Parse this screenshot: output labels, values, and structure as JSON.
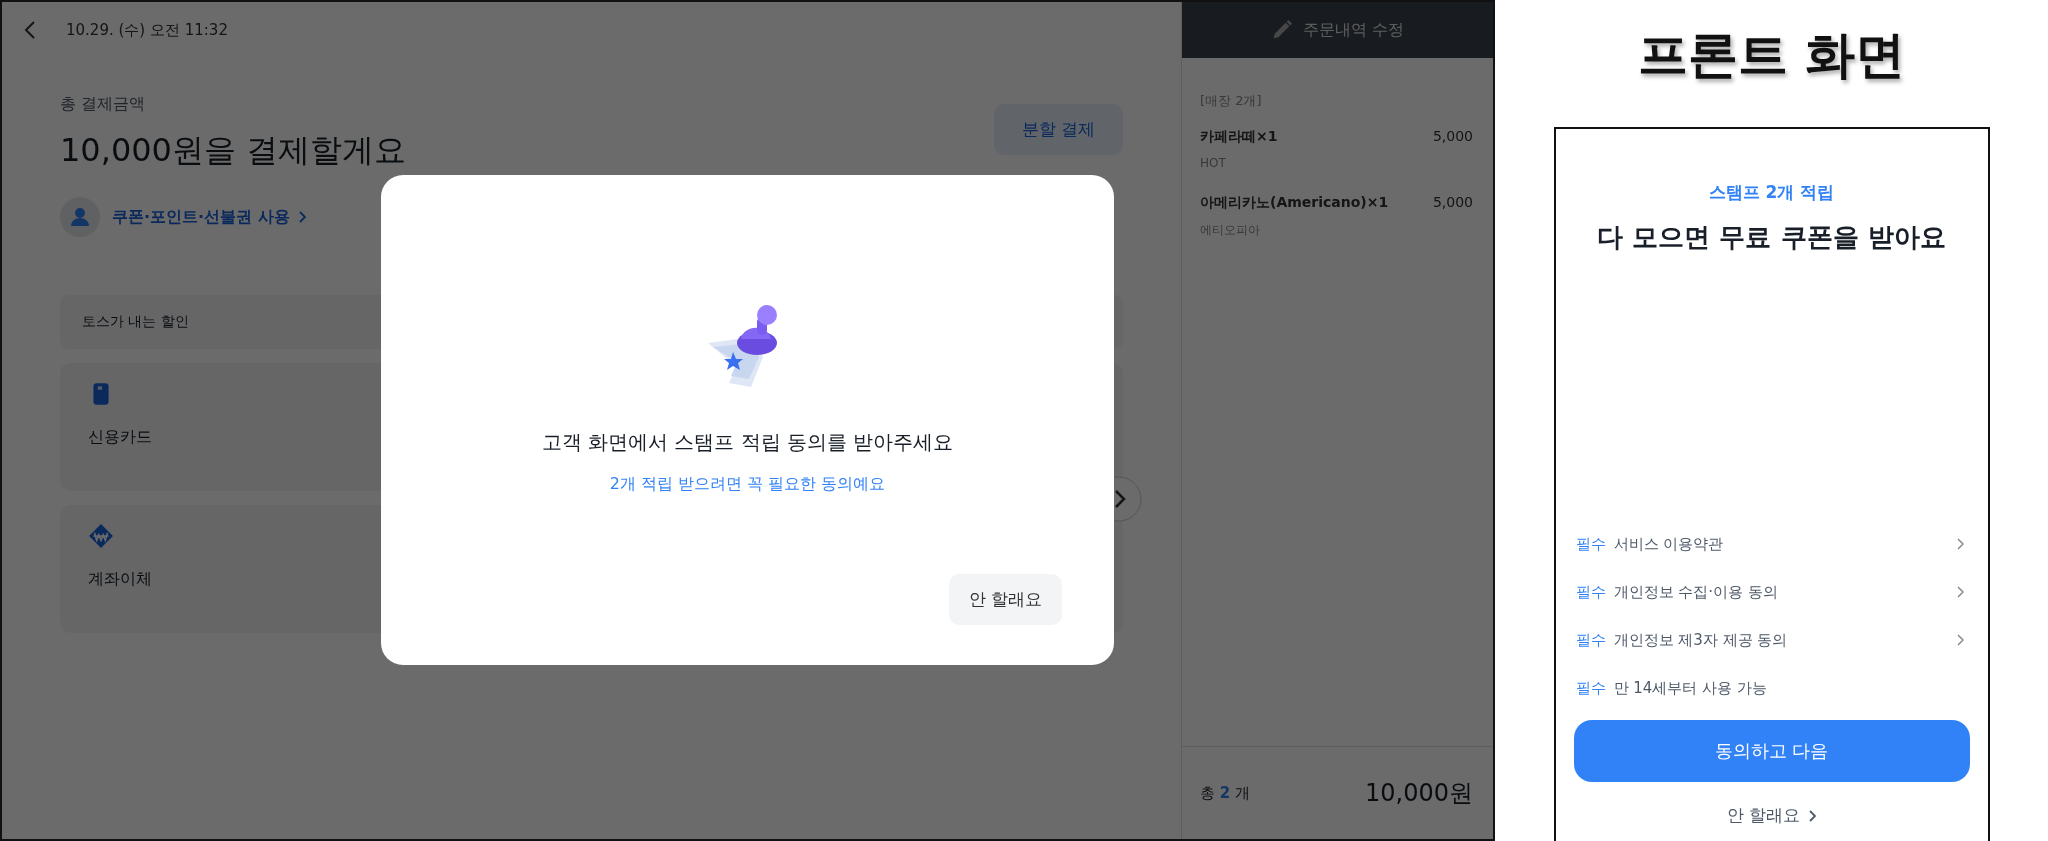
{
  "pos": {
    "date": "10.29. (수) 오전 11:32",
    "total_label": "총 결제금액",
    "total_title": "10,000원을 결제할게요",
    "split_button": "분할 결제",
    "coupon_link": "쿠폰·포인트·선불권 사용",
    "discount_label": "토스가 내는 할인",
    "methods": [
      {
        "label": "신용카드",
        "kind": "card"
      },
      {
        "label": "계좌이체",
        "kind": "transfer"
      }
    ]
  },
  "order_panel": {
    "edit_button": "주문내역 수정",
    "group": "[매장 2개]",
    "items": [
      {
        "name": "카페라떼×1",
        "price": "5,000",
        "option": "HOT"
      },
      {
        "name": "아메리카노(Americano)×1",
        "price": "5,000",
        "option": "에티오피아"
      }
    ],
    "total_prefix": "총",
    "total_count": "2",
    "total_suffix": "개",
    "total_amount": "10,000원"
  },
  "dialog": {
    "title": "고객 화면에서 스탬프 적립 동의를 받아주세요",
    "subtitle": "2개 적립 받으려면 꼭 필요한 동의예요",
    "button": "안 할래요"
  },
  "front": {
    "caption": "프론트 화면",
    "eyebrow": "스탬프 2개 적립",
    "title": "다 모으면 무료 쿠폰을 받아요",
    "terms": [
      {
        "tag": "필수",
        "text": "서비스 이용약관",
        "arrow": true
      },
      {
        "tag": "필수",
        "text": "개인정보 수집·이용 동의",
        "arrow": true
      },
      {
        "tag": "필수",
        "text": "개인정보 제3자 제공 동의",
        "arrow": true
      },
      {
        "tag": "필수",
        "text": "만 14세부터 사용 가능",
        "arrow": false
      }
    ],
    "primary_button": "동의하고 다음",
    "decline_link": "안 할래요"
  }
}
